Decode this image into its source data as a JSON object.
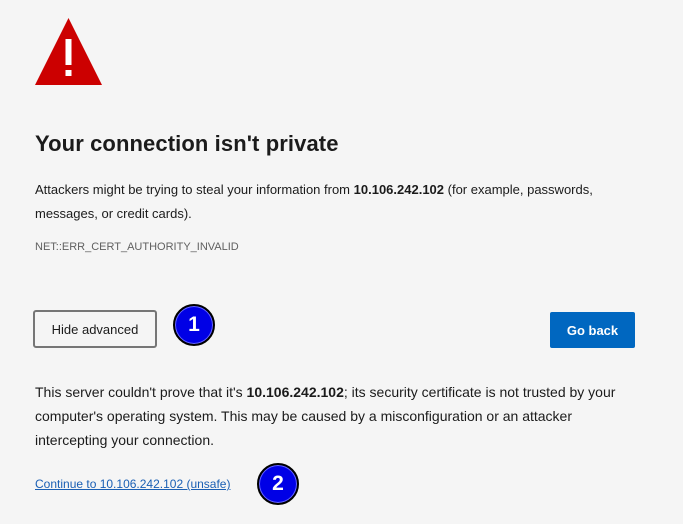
{
  "icons": {
    "warning": "warning-triangle-icon"
  },
  "colors": {
    "warning_red": "#cc0000",
    "primary_button": "#0067c0",
    "link": "#1a5fb4",
    "badge": "#0000e6",
    "background": "#f5f5f5"
  },
  "page": {
    "title": "Your connection isn't private",
    "description": {
      "before": "Attackers might be trying to steal your information from ",
      "host": "10.106.242.102",
      "after": " (for example, passwords, messages, or credit cards)."
    },
    "error_code": "NET::ERR_CERT_AUTHORITY_INVALID"
  },
  "buttons": {
    "hide_advanced": "Hide advanced",
    "go_back": "Go back"
  },
  "advanced": {
    "before": "This server couldn't prove that it's ",
    "host": "10.106.242.102",
    "after": "; its security certificate is not trusted by your computer's operating system. This may be caused by a misconfiguration or an attacker intercepting your connection.",
    "continue_link": "Continue to 10.106.242.102 (unsafe)"
  },
  "annotations": {
    "badge_1": "1",
    "badge_2": "2"
  }
}
